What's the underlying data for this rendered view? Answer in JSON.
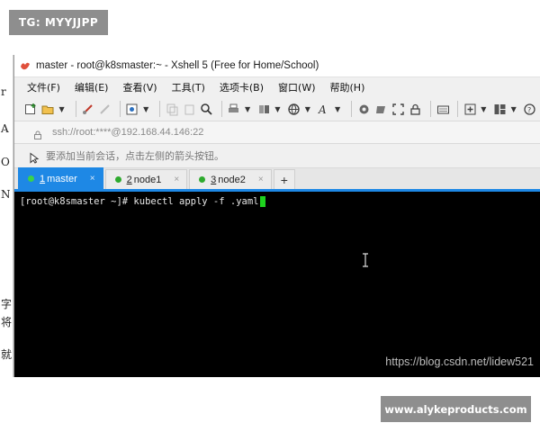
{
  "overlay": {
    "top_badge": "TG: MYYJJPP",
    "bottom_badge": "www.alykeproducts.com"
  },
  "background_window": {
    "edge_glyphs": [
      "r",
      "A",
      "O",
      "N",
      "字",
      "将",
      "就"
    ]
  },
  "window": {
    "title": "master - root@k8smaster:~ - Xshell 5 (Free for Home/School)",
    "menu": [
      "文件(F)",
      "编辑(E)",
      "查看(V)",
      "工具(T)",
      "选项卡(B)",
      "窗口(W)",
      "帮助(H)"
    ],
    "address": "ssh://root:****@192.168.44.146:22",
    "hint": "要添加当前会话，点击左侧的箭头按钮。",
    "tabs": [
      {
        "num": "1",
        "label": " master",
        "close": "×"
      },
      {
        "num": "2",
        "label": " node1",
        "close": "×"
      },
      {
        "num": "3",
        "label": " node2",
        "close": "×"
      }
    ],
    "add_tab": "+"
  },
  "terminal": {
    "command_line": "[root@k8smaster ~]# kubectl apply -f .yaml",
    "watermark": "https://blog.csdn.net/lidew521"
  },
  "colors": {
    "accent": "#1e88e5",
    "terminal_bg": "#000000",
    "cursor": "#1ed31e",
    "connected_dot": "#2eaa2e"
  }
}
